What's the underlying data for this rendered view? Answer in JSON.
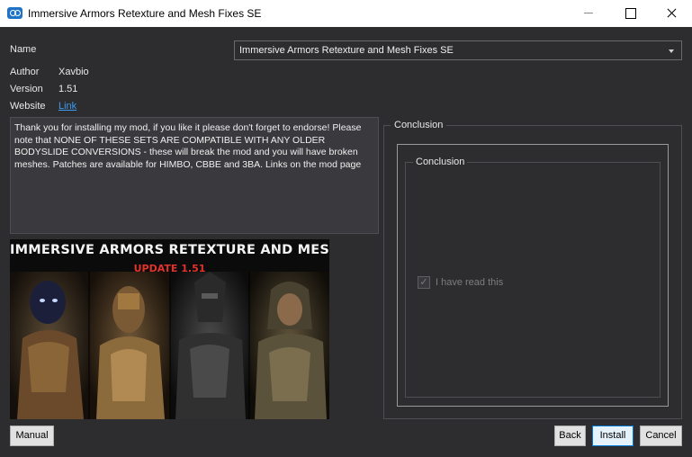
{
  "window": {
    "title": "Immersive Armors Retexture and Mesh Fixes SE"
  },
  "info": {
    "name_label": "Name",
    "name_value": "Immersive Armors Retexture and Mesh Fixes SE",
    "author_label": "Author",
    "author_value": "Xavbio",
    "version_label": "Version",
    "version_value": "1.51",
    "website_label": "Website",
    "website_link": "Link"
  },
  "description": "Thank you for installing my mod, if you like it please don't forget to endorse! Please note that NONE OF THESE SETS ARE COMPATIBLE WITH ANY OLDER BODYSLIDE CONVERSIONS - these will break the mod and you will have broken meshes. Patches are available for HIMBO, CBBE and 3BA. Links on the mod page",
  "image": {
    "title": "IMMERSIVE ARMORS RETEXTURE AND MESH FIXES SE",
    "update": "UPDATE 1.51"
  },
  "step": {
    "group_title": "Conclusion",
    "inner_group_title": "Conclusion",
    "checkbox_label": "I have read this",
    "checkbox_checked": true,
    "checkbox_enabled": false
  },
  "buttons": {
    "manual": "Manual",
    "back": "Back",
    "install": "Install",
    "cancel": "Cancel"
  },
  "colors": {
    "background": "#2d2d30",
    "link": "#3c9bf0",
    "update_text": "#e2322b",
    "accent": "#0078d7"
  }
}
